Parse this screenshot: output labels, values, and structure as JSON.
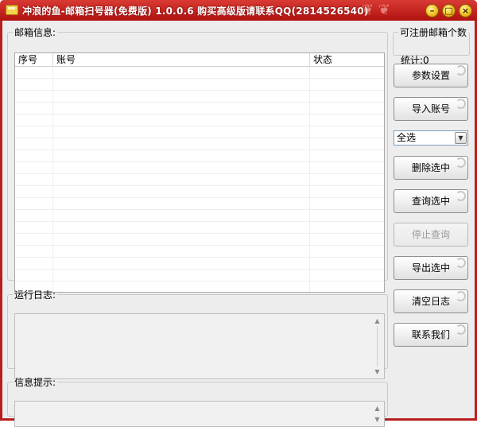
{
  "window": {
    "title": "冲浪的鱼-邮箱扫号器(免费版) 1.0.0.6 购买高级版请联系QQ(2814526540)",
    "buttons": {
      "minimize": "–",
      "maximize": "□",
      "close": "×"
    }
  },
  "mail_group": {
    "legend": "邮箱信息:",
    "columns": [
      "序号",
      "账号",
      "状态"
    ]
  },
  "count_group": {
    "legend": "可注册邮箱个数",
    "count_label": "统计:0"
  },
  "log_group": {
    "legend": "运行日志:"
  },
  "info_group": {
    "legend": "信息提示:"
  },
  "controls": {
    "param_settings": "参数设置",
    "import_accounts": "导入账号",
    "select_value": "全选",
    "delete_selected": "删除选中",
    "query_selected": "查询选中",
    "stop_query": "停止查询",
    "export_selected": "导出选中",
    "clear_log": "清空日志",
    "contact_us": "联系我们"
  },
  "colors": {
    "title_bar": "#b81e1e",
    "client_bg": "#ededed"
  },
  "icons": {
    "app": "envelope-icon",
    "minimize": "minimize-icon",
    "maximize": "maximize-icon",
    "close": "close-icon"
  }
}
